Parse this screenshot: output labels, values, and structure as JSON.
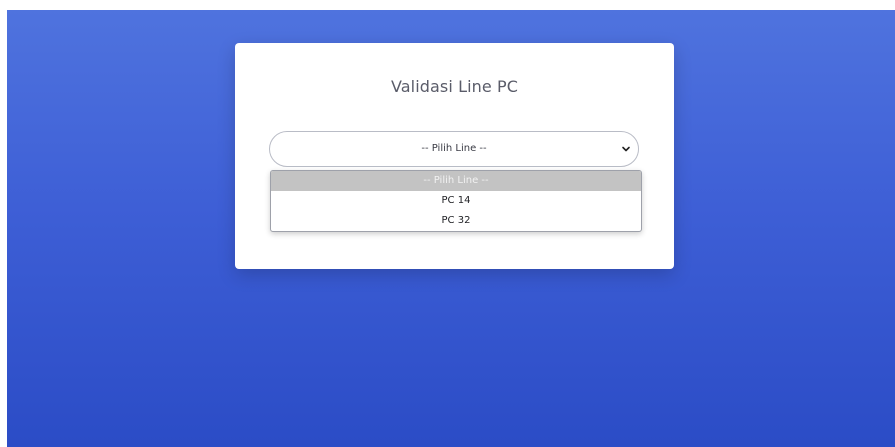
{
  "card": {
    "title": "Validasi Line PC"
  },
  "line_select": {
    "selected": "-- Pilih Line --",
    "options": [
      "-- Pilih Line --",
      "PC 14",
      "PC 32"
    ],
    "highlighted_index": 0
  },
  "colors": {
    "background_top": "#4f73de",
    "background_bottom": "#2b4cc6",
    "card": "#ffffff",
    "option_highlight": "#c3c3c3"
  },
  "icons": {
    "select_arrow": "chevron-down-icon"
  }
}
